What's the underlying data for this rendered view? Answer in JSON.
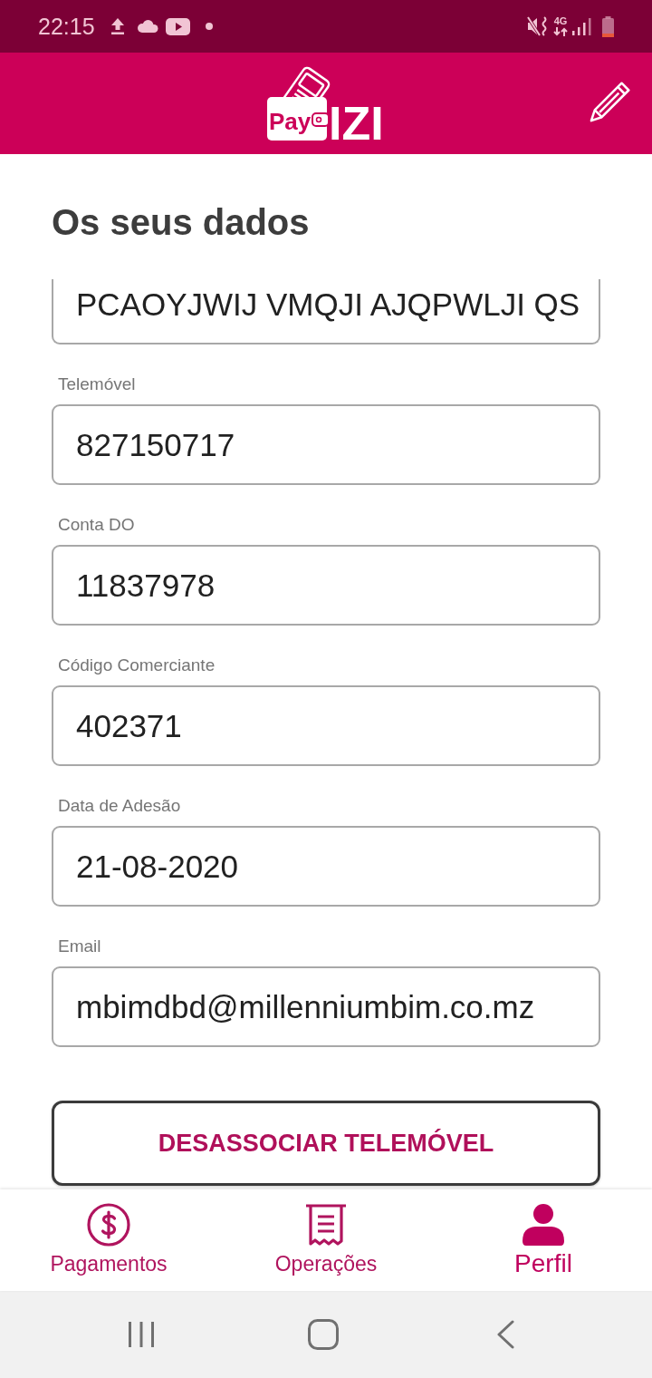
{
  "status_bar": {
    "time": "22:15",
    "network_type": "4G"
  },
  "header": {
    "logo": {
      "prefix": "Pay",
      "name": "IZI"
    }
  },
  "page_title": "Os seus dados",
  "fields": [
    {
      "kind": "partial",
      "value": "PCAOYJWIJ VMQJI AJQPWLJI QS"
    },
    {
      "kind": "full",
      "label": "Telemóvel",
      "value": "827150717"
    },
    {
      "kind": "full",
      "label": "Conta DO",
      "value": "11837978"
    },
    {
      "kind": "full",
      "label": "Código Comerciante",
      "value": "402371"
    },
    {
      "kind": "full",
      "label": "Data de Adesão",
      "value": "21-08-2020"
    },
    {
      "kind": "full",
      "label": "Email",
      "value": "mbimdbd@millenniumbim.co.mz"
    }
  ],
  "unlink_button": {
    "label": "DESASSOCIAR TELEMÓVEL"
  },
  "bottom_nav": [
    {
      "label": "Pagamentos",
      "selected": false
    },
    {
      "label": "Operações",
      "selected": false
    },
    {
      "label": "Perfil",
      "selected": true
    }
  ]
}
